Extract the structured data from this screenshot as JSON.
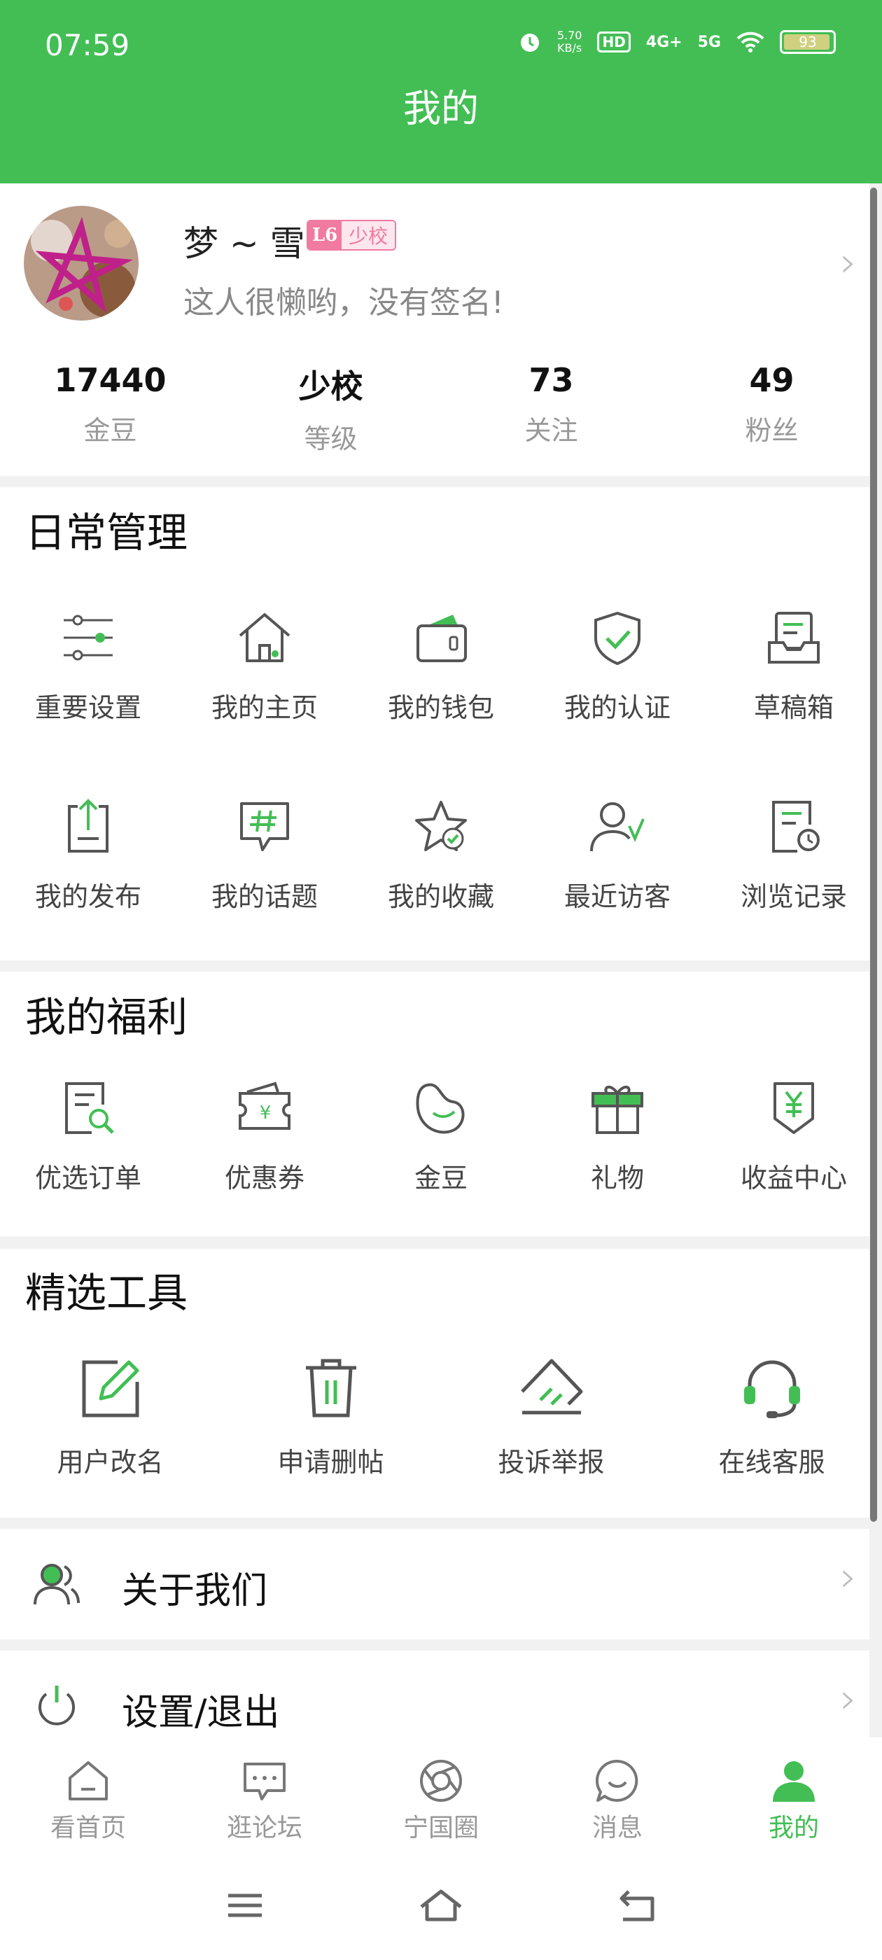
{
  "status_bar": {
    "time": "07:59",
    "speed_value": "5.70",
    "speed_unit": "KB/s",
    "hd": "HD",
    "net1": "4G+",
    "net2": "5G",
    "battery": "93"
  },
  "page_title": "我的",
  "profile": {
    "name": "梦 ~ 雪",
    "level": "L6",
    "rank": "少校",
    "signature": "这人很懒哟，没有签名!"
  },
  "stats": [
    {
      "value": "17440",
      "label": "金豆"
    },
    {
      "value": "少校",
      "label": "等级"
    },
    {
      "value": "73",
      "label": "关注"
    },
    {
      "value": "49",
      "label": "粉丝"
    }
  ],
  "daily": {
    "title": "日常管理",
    "items": [
      {
        "label": "重要设置",
        "icon": "sliders-icon"
      },
      {
        "label": "我的主页",
        "icon": "home-icon"
      },
      {
        "label": "我的钱包",
        "icon": "wallet-icon"
      },
      {
        "label": "我的认证",
        "icon": "shield-check-icon"
      },
      {
        "label": "草稿箱",
        "icon": "inbox-icon"
      },
      {
        "label": "我的发布",
        "icon": "upload-doc-icon"
      },
      {
        "label": "我的话题",
        "icon": "hashtag-chat-icon"
      },
      {
        "label": "我的收藏",
        "icon": "star-check-icon"
      },
      {
        "label": "最近访客",
        "icon": "user-check-icon"
      },
      {
        "label": "浏览记录",
        "icon": "history-doc-icon"
      }
    ]
  },
  "welfare": {
    "title": "我的福利",
    "items": [
      {
        "label": "优选订单",
        "icon": "order-search-icon"
      },
      {
        "label": "优惠券",
        "icon": "coupon-icon"
      },
      {
        "label": "金豆",
        "icon": "bean-icon"
      },
      {
        "label": "礼物",
        "icon": "gift-icon"
      },
      {
        "label": "收益中心",
        "icon": "yen-icon"
      }
    ]
  },
  "tools": {
    "title": "精选工具",
    "items": [
      {
        "label": "用户改名",
        "icon": "edit-icon"
      },
      {
        "label": "申请删帖",
        "icon": "trash-icon"
      },
      {
        "label": "投诉举报",
        "icon": "report-icon"
      },
      {
        "label": "在线客服",
        "icon": "headset-icon"
      }
    ]
  },
  "rows": [
    {
      "label": "关于我们",
      "icon": "users-icon"
    },
    {
      "label": "设置/退出",
      "icon": "power-icon"
    }
  ],
  "tabs": [
    {
      "label": "看首页",
      "icon": "home-tab-icon"
    },
    {
      "label": "逛论坛",
      "icon": "chat-dots-icon"
    },
    {
      "label": "宁国圈",
      "icon": "aperture-icon"
    },
    {
      "label": "消息",
      "icon": "message-icon"
    },
    {
      "label": "我的",
      "icon": "person-icon",
      "active": true
    }
  ],
  "colors": {
    "accent": "#43be55",
    "badge": "#f07aa0"
  }
}
